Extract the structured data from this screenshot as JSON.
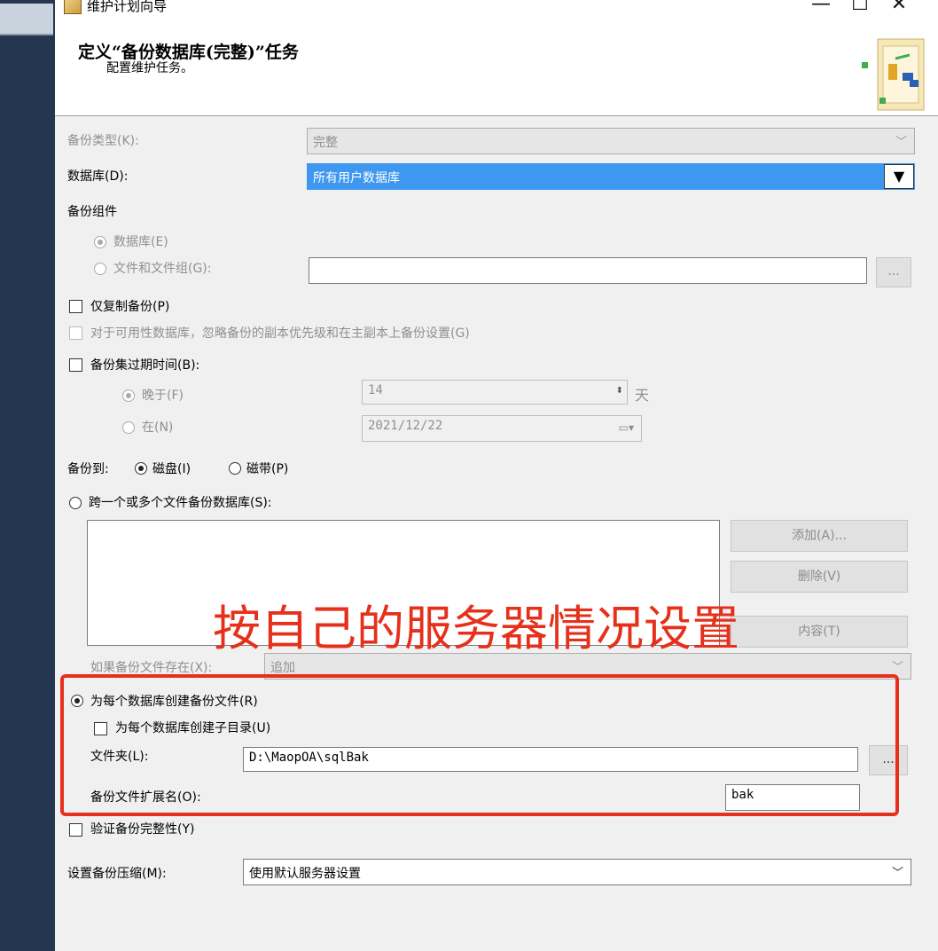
{
  "window": {
    "title": "维护计划向导",
    "minimize_glyph": "—",
    "maximize_glyph": "☐",
    "close_glyph": "✕"
  },
  "header": {
    "title": "定义“备份数据库(完整)”任务",
    "subtitle": "配置维护任务。"
  },
  "backup_type": {
    "label": "备份类型(K):",
    "value": "完整"
  },
  "database": {
    "label": "数据库(D):",
    "value": "所有用户数据库",
    "arrow": "▼"
  },
  "backup_component": {
    "label": "备份组件",
    "database_option": "数据库(E)",
    "files_option": "文件和文件组(G):",
    "browse": "..."
  },
  "copy_only": {
    "label": "仅复制备份(P)"
  },
  "ignore_replica": {
    "label": "对于可用性数据库，忽略备份的副本优先级和在主副本上备份设置(G)"
  },
  "expire": {
    "label": "备份集过期时间(B):",
    "after_label": "晚于(F)",
    "after_value": "14",
    "after_unit": "天",
    "on_label": "在(N)",
    "on_value": "2021/12/22"
  },
  "backup_to": {
    "label": "备份到:",
    "disk": "磁盘(I)",
    "tape": "磁带(P)"
  },
  "span_files": {
    "label": "跨一个或多个文件备份数据库(S):",
    "add_button": "添加(A)...",
    "remove_button": "删除(V)",
    "contents_button": "内容(T)"
  },
  "if_exists": {
    "label": "如果备份文件存在(X):",
    "value": "追加"
  },
  "annotation": {
    "text": "按自己的服务器情况设置"
  },
  "per_db": {
    "label": "为每个数据库创建备份文件(R)",
    "subdir_label": "为每个数据库创建子目录(U)",
    "folder_label": "文件夹(L):",
    "folder_value": "D:\\MaopOA\\sqlBak",
    "folder_browse": "...",
    "ext_label": "备份文件扩展名(O):",
    "ext_value": "bak"
  },
  "verify": {
    "label": "验证备份完整性(Y)"
  },
  "compression": {
    "label": "设置备份压缩(M):",
    "value": "使用默认服务器设置"
  },
  "colors": {
    "selection": "#3e98f0",
    "annotation": "#e5311c"
  }
}
